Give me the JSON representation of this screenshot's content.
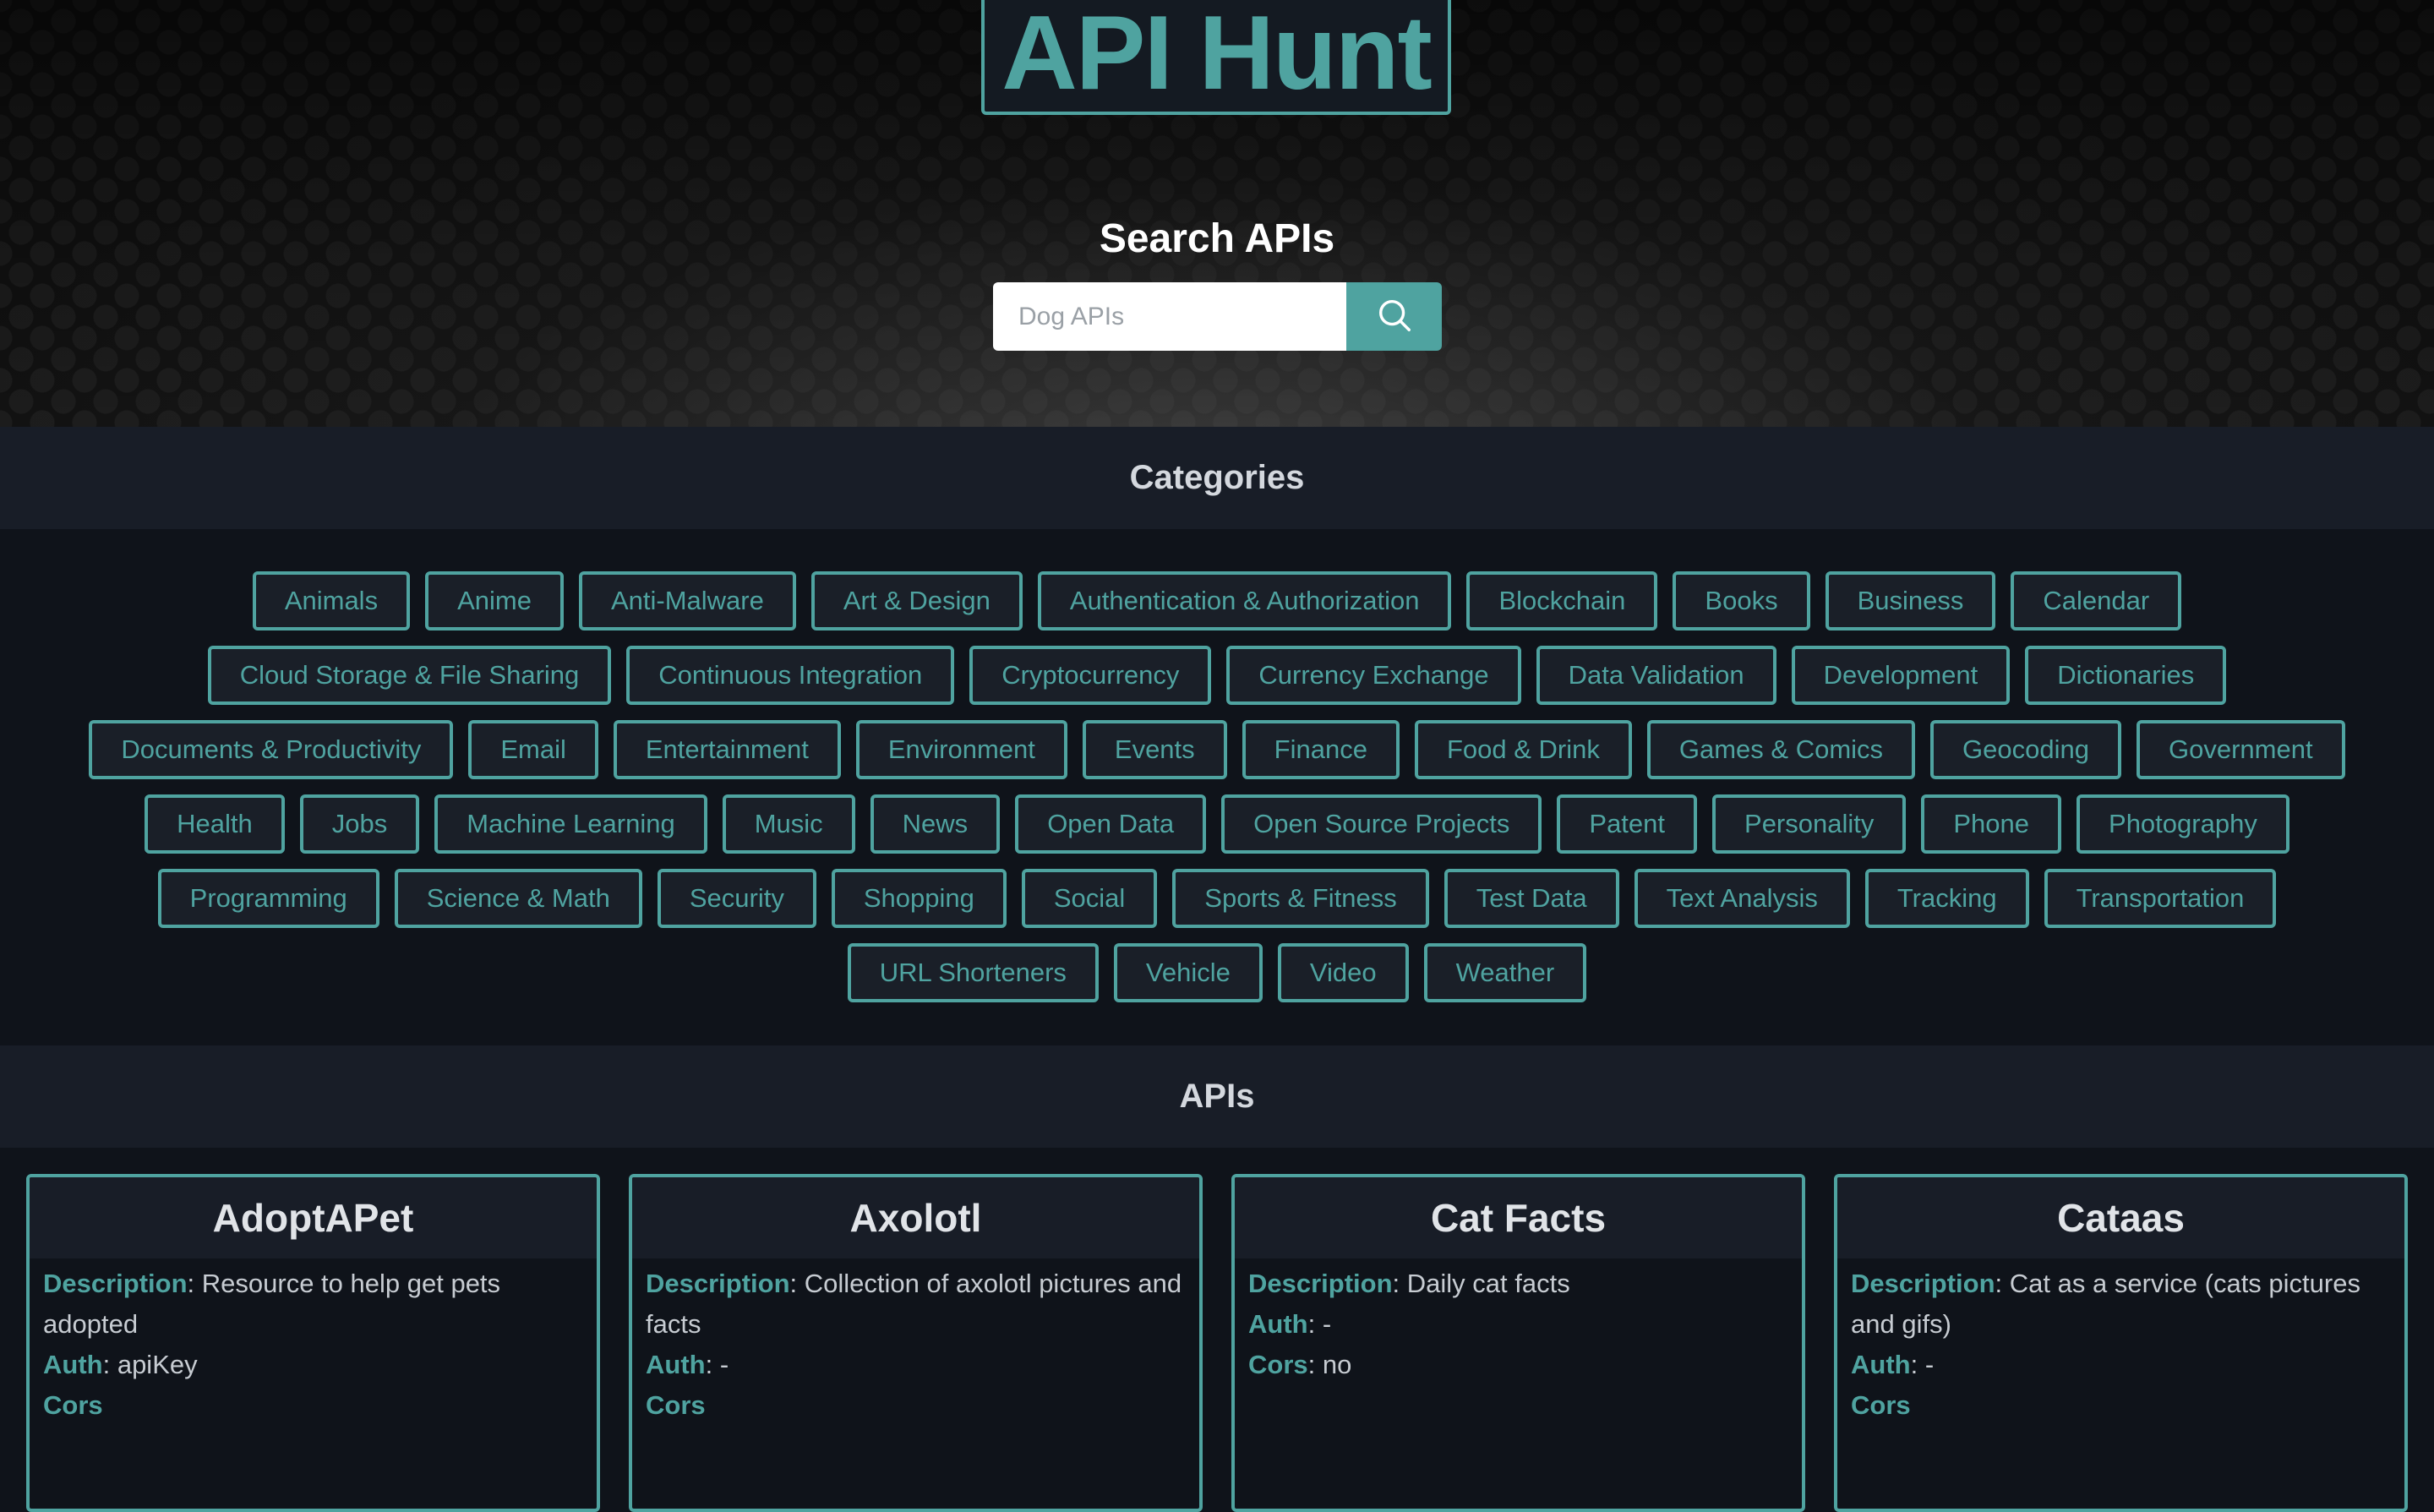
{
  "header": {
    "logo_text": "API Hunt",
    "search_title": "Search APIs",
    "search_placeholder": "Dog APIs"
  },
  "categories": {
    "heading": "Categories",
    "rows": [
      [
        "Animals",
        "Anime",
        "Anti-Malware",
        "Art & Design",
        "Authentication & Authorization",
        "Blockchain",
        "Books",
        "Business",
        "Calendar"
      ],
      [
        "Cloud Storage & File Sharing",
        "Continuous Integration",
        "Cryptocurrency",
        "Currency Exchange",
        "Data Validation",
        "Development",
        "Dictionaries"
      ],
      [
        "Documents & Productivity",
        "Email",
        "Entertainment",
        "Environment",
        "Events",
        "Finance",
        "Food & Drink",
        "Games & Comics",
        "Geocoding",
        "Government"
      ],
      [
        "Health",
        "Jobs",
        "Machine Learning",
        "Music",
        "News",
        "Open Data",
        "Open Source Projects",
        "Patent",
        "Personality",
        "Phone",
        "Photography"
      ],
      [
        "Programming",
        "Science & Math",
        "Security",
        "Shopping",
        "Social",
        "Sports & Fitness",
        "Test Data",
        "Text Analysis",
        "Tracking",
        "Transportation"
      ],
      [
        "URL Shorteners",
        "Vehicle",
        "Video",
        "Weather"
      ]
    ]
  },
  "apis": {
    "heading": "APIs",
    "labels": {
      "description": "Description",
      "auth": "Auth",
      "cors": "Cors"
    },
    "cards": [
      {
        "name": "AdoptAPet",
        "description": "Resource to help get pets adopted",
        "auth": "apiKey",
        "cors": ""
      },
      {
        "name": "Axolotl",
        "description": "Collection of axolotl pictures and facts",
        "auth": "-",
        "cors": ""
      },
      {
        "name": "Cat Facts",
        "description": "Daily cat facts",
        "auth": "-",
        "cors": "no"
      },
      {
        "name": "Cataas",
        "description": "Cat as a service (cats pictures and gifs)",
        "auth": "-",
        "cors": ""
      }
    ]
  },
  "colors": {
    "accent": "#4fa3a0",
    "background": "#0f131a",
    "section_header": "#181d27"
  },
  "icons": {
    "search_button": "search-icon"
  }
}
